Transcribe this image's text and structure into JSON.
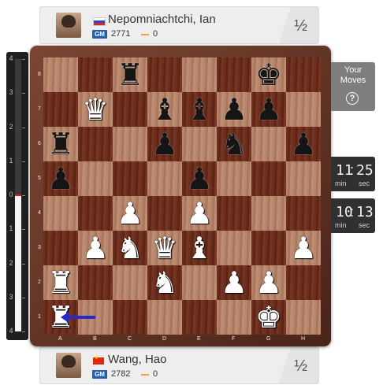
{
  "players": {
    "top": {
      "name": "Nepomniachtchi, Ian",
      "title": "GM",
      "rating": "2771",
      "rating_change": "0",
      "result": "½",
      "flag": "RU"
    },
    "bottom": {
      "name": "Wang, Hao",
      "title": "GM",
      "rating": "2782",
      "rating_change": "0",
      "result": "½",
      "flag": "CN"
    }
  },
  "eval_bar": {
    "labels": [
      "4",
      "3",
      "2",
      "1",
      "0",
      "1",
      "2",
      "3",
      "4"
    ],
    "evaluation": 0.0
  },
  "board": {
    "files": [
      "A",
      "B",
      "C",
      "D",
      "E",
      "F",
      "G",
      "H"
    ],
    "ranks": [
      "8",
      "7",
      "6",
      "5",
      "4",
      "3",
      "2",
      "1"
    ],
    "position": [
      [
        "",
        "",
        "r",
        "",
        "",
        "",
        "k",
        ""
      ],
      [
        "",
        "Q",
        "",
        "b",
        "b",
        "p",
        "p",
        ""
      ],
      [
        "r",
        "",
        "",
        "p",
        "",
        "n",
        "",
        "p"
      ],
      [
        "p",
        "",
        "",
        "",
        "p",
        "",
        "",
        ""
      ],
      [
        "",
        "",
        "P",
        "",
        "P",
        "",
        "",
        ""
      ],
      [
        "",
        "P",
        "N",
        "Q",
        "B",
        "",
        "",
        "P"
      ],
      [
        "R",
        "",
        "",
        "N",
        "",
        "P",
        "P",
        ""
      ],
      [
        "R",
        "",
        "",
        "",
        "",
        "",
        "K",
        ""
      ]
    ],
    "last_move_arrow": {
      "from": "b1",
      "to": "a1",
      "color": "#2828c8"
    }
  },
  "side_panel": {
    "your_moves_label": "Your Moves",
    "help_icon": "?"
  },
  "clocks": {
    "top": {
      "minutes": "11",
      "seconds": "25",
      "min_label": "min",
      "sec_label": "sec"
    },
    "bottom": {
      "minutes": "10",
      "seconds": "13",
      "min_label": "min",
      "sec_label": "sec"
    }
  }
}
